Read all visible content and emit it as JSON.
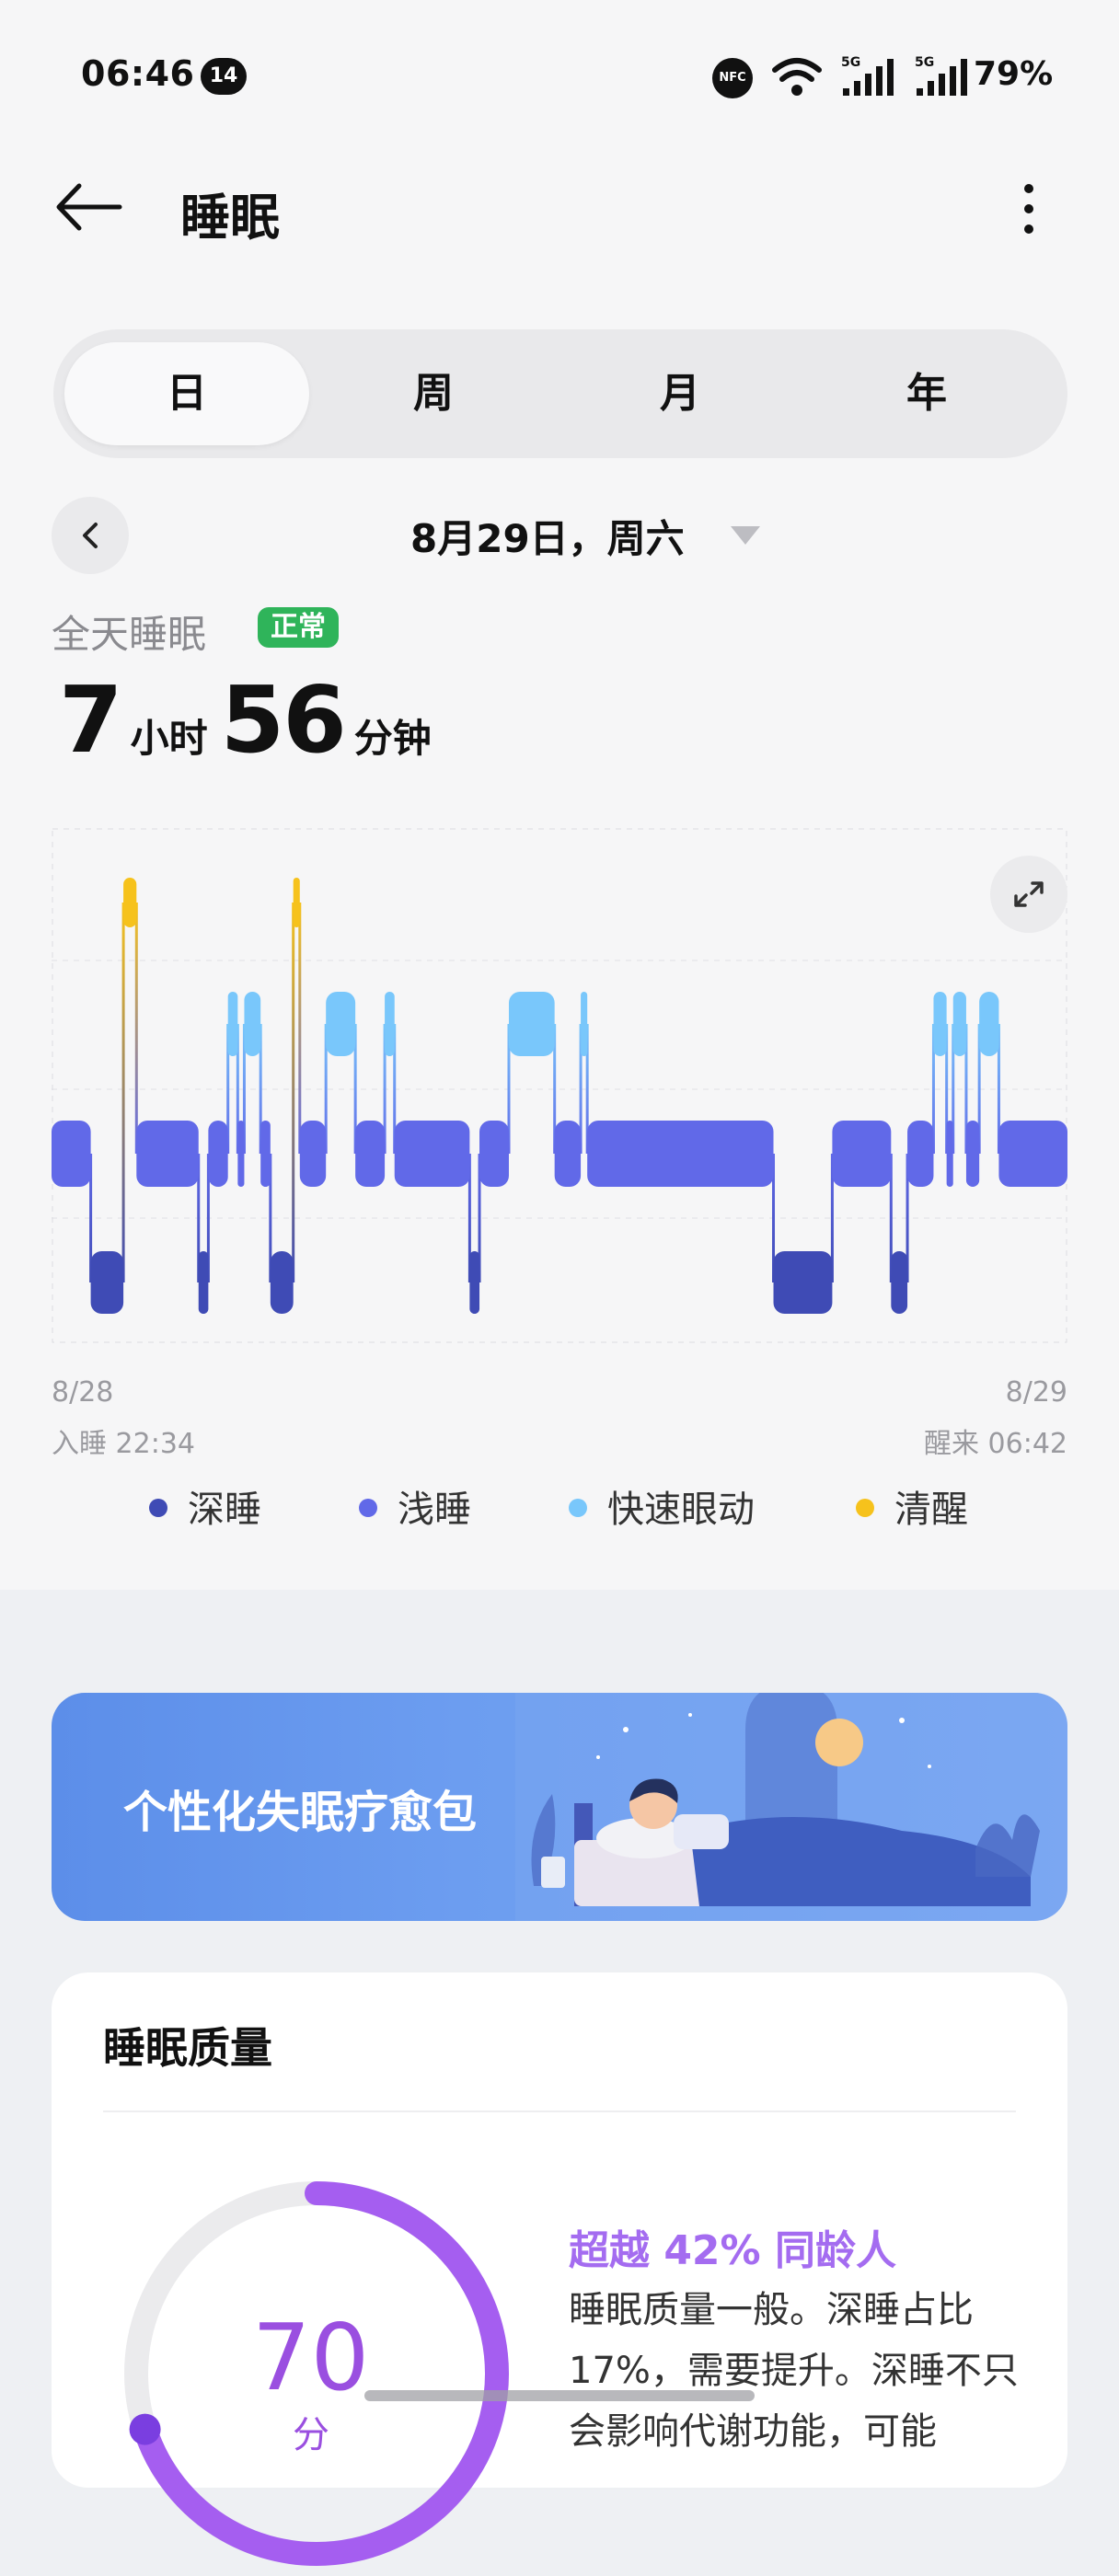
{
  "status_bar": {
    "time": "06:46",
    "notification_count": "14",
    "nfc_label": "NFC",
    "network_1": "5G",
    "network_2": "5G",
    "battery": "79%"
  },
  "header": {
    "title": "睡眠"
  },
  "tabs": [
    {
      "label": "日",
      "active": true
    },
    {
      "label": "周",
      "active": false
    },
    {
      "label": "月",
      "active": false
    },
    {
      "label": "年",
      "active": false
    }
  ],
  "date_nav": {
    "date": "8月29日，周六"
  },
  "summary": {
    "label": "全天睡眠",
    "badge": "正常",
    "hours": "7",
    "hours_unit": "小时",
    "minutes": "56",
    "minutes_unit": "分钟"
  },
  "chart_data": {
    "type": "bar",
    "x_start_label": "8/28",
    "x_end_label": "8/29",
    "sleep_start": "入睡 22:34",
    "wake_end": "醒来 06:42",
    "stages": [
      {
        "name": "深睡",
        "color": "#3f4bb5"
      },
      {
        "name": "浅睡",
        "color": "#6169e8"
      },
      {
        "name": "快速眼动",
        "color": "#79c7fb"
      },
      {
        "name": "清醒",
        "color": "#f6c21c"
      }
    ],
    "timeline": [
      {
        "start": "22:34",
        "end": "22:46",
        "stage": "浅睡"
      },
      {
        "start": "22:46",
        "end": "22:56",
        "stage": "深睡"
      },
      {
        "start": "22:56",
        "end": "23:00",
        "stage": "清醒"
      },
      {
        "start": "23:00",
        "end": "23:19",
        "stage": "浅睡"
      },
      {
        "start": "23:19",
        "end": "23:22",
        "stage": "深睡"
      },
      {
        "start": "23:22",
        "end": "23:28",
        "stage": "浅睡"
      },
      {
        "start": "23:28",
        "end": "23:31",
        "stage": "快速眼动"
      },
      {
        "start": "23:31",
        "end": "23:33",
        "stage": "浅睡"
      },
      {
        "start": "23:33",
        "end": "23:38",
        "stage": "快速眼动"
      },
      {
        "start": "23:38",
        "end": "23:41",
        "stage": "浅睡"
      },
      {
        "start": "23:41",
        "end": "23:48",
        "stage": "深睡"
      },
      {
        "start": "23:48",
        "end": "23:50",
        "stage": "清醒"
      },
      {
        "start": "23:50",
        "end": "23:58",
        "stage": "浅睡"
      },
      {
        "start": "23:58",
        "end": "00:07",
        "stage": "快速眼动"
      },
      {
        "start": "00:07",
        "end": "00:16",
        "stage": "浅睡"
      },
      {
        "start": "00:16",
        "end": "00:19",
        "stage": "快速眼动"
      },
      {
        "start": "00:19",
        "end": "00:42",
        "stage": "浅睡"
      },
      {
        "start": "00:42",
        "end": "00:45",
        "stage": "深睡"
      },
      {
        "start": "00:45",
        "end": "00:54",
        "stage": "浅睡"
      },
      {
        "start": "00:54",
        "end": "01:08",
        "stage": "快速眼动"
      },
      {
        "start": "01:08",
        "end": "01:16",
        "stage": "浅睡"
      },
      {
        "start": "01:16",
        "end": "01:18",
        "stage": "快速眼动"
      },
      {
        "start": "01:18",
        "end": "02:15",
        "stage": "浅睡"
      },
      {
        "start": "02:15",
        "end": "02:33",
        "stage": "深睡"
      },
      {
        "start": "02:33",
        "end": "02:51",
        "stage": "浅睡"
      },
      {
        "start": "02:51",
        "end": "02:56",
        "stage": "深睡"
      },
      {
        "start": "02:56",
        "end": "03:04",
        "stage": "浅睡"
      },
      {
        "start": "03:04",
        "end": "03:08",
        "stage": "快速眼动"
      },
      {
        "start": "03:08",
        "end": "03:10",
        "stage": "浅睡"
      },
      {
        "start": "03:10",
        "end": "03:14",
        "stage": "快速眼动"
      },
      {
        "start": "03:14",
        "end": "03:18",
        "stage": "浅睡"
      },
      {
        "start": "03:18",
        "end": "03:24",
        "stage": "快速眼动"
      },
      {
        "start": "03:24",
        "end": "03:45",
        "stage": "浅睡"
      }
    ],
    "note": "Chart x-axis is compressed; end labels read 8/28 入睡 22:34 and 8/29 醒来 06:42."
  },
  "legend": [
    {
      "label": "深睡",
      "color": "#3f4bb5"
    },
    {
      "label": "浅睡",
      "color": "#6169e8"
    },
    {
      "label": "快速眼动",
      "color": "#79c7fb"
    },
    {
      "label": "清醒",
      "color": "#f6c21c"
    }
  ],
  "banner": {
    "title": "个性化失眠疗愈包"
  },
  "quality_card": {
    "title": "睡眠质量",
    "score": "70",
    "score_unit": "分",
    "score_value": 70,
    "rank_text": "超越 42% 同龄人",
    "description": "睡眠质量一般。深睡占比17%，需要提升。深睡不只会影响代谢功能，可能"
  },
  "colors": {
    "accent_purple": "#9a4fe0",
    "badge_green": "#2fb45a",
    "banner_blue": "#6c9df0"
  }
}
